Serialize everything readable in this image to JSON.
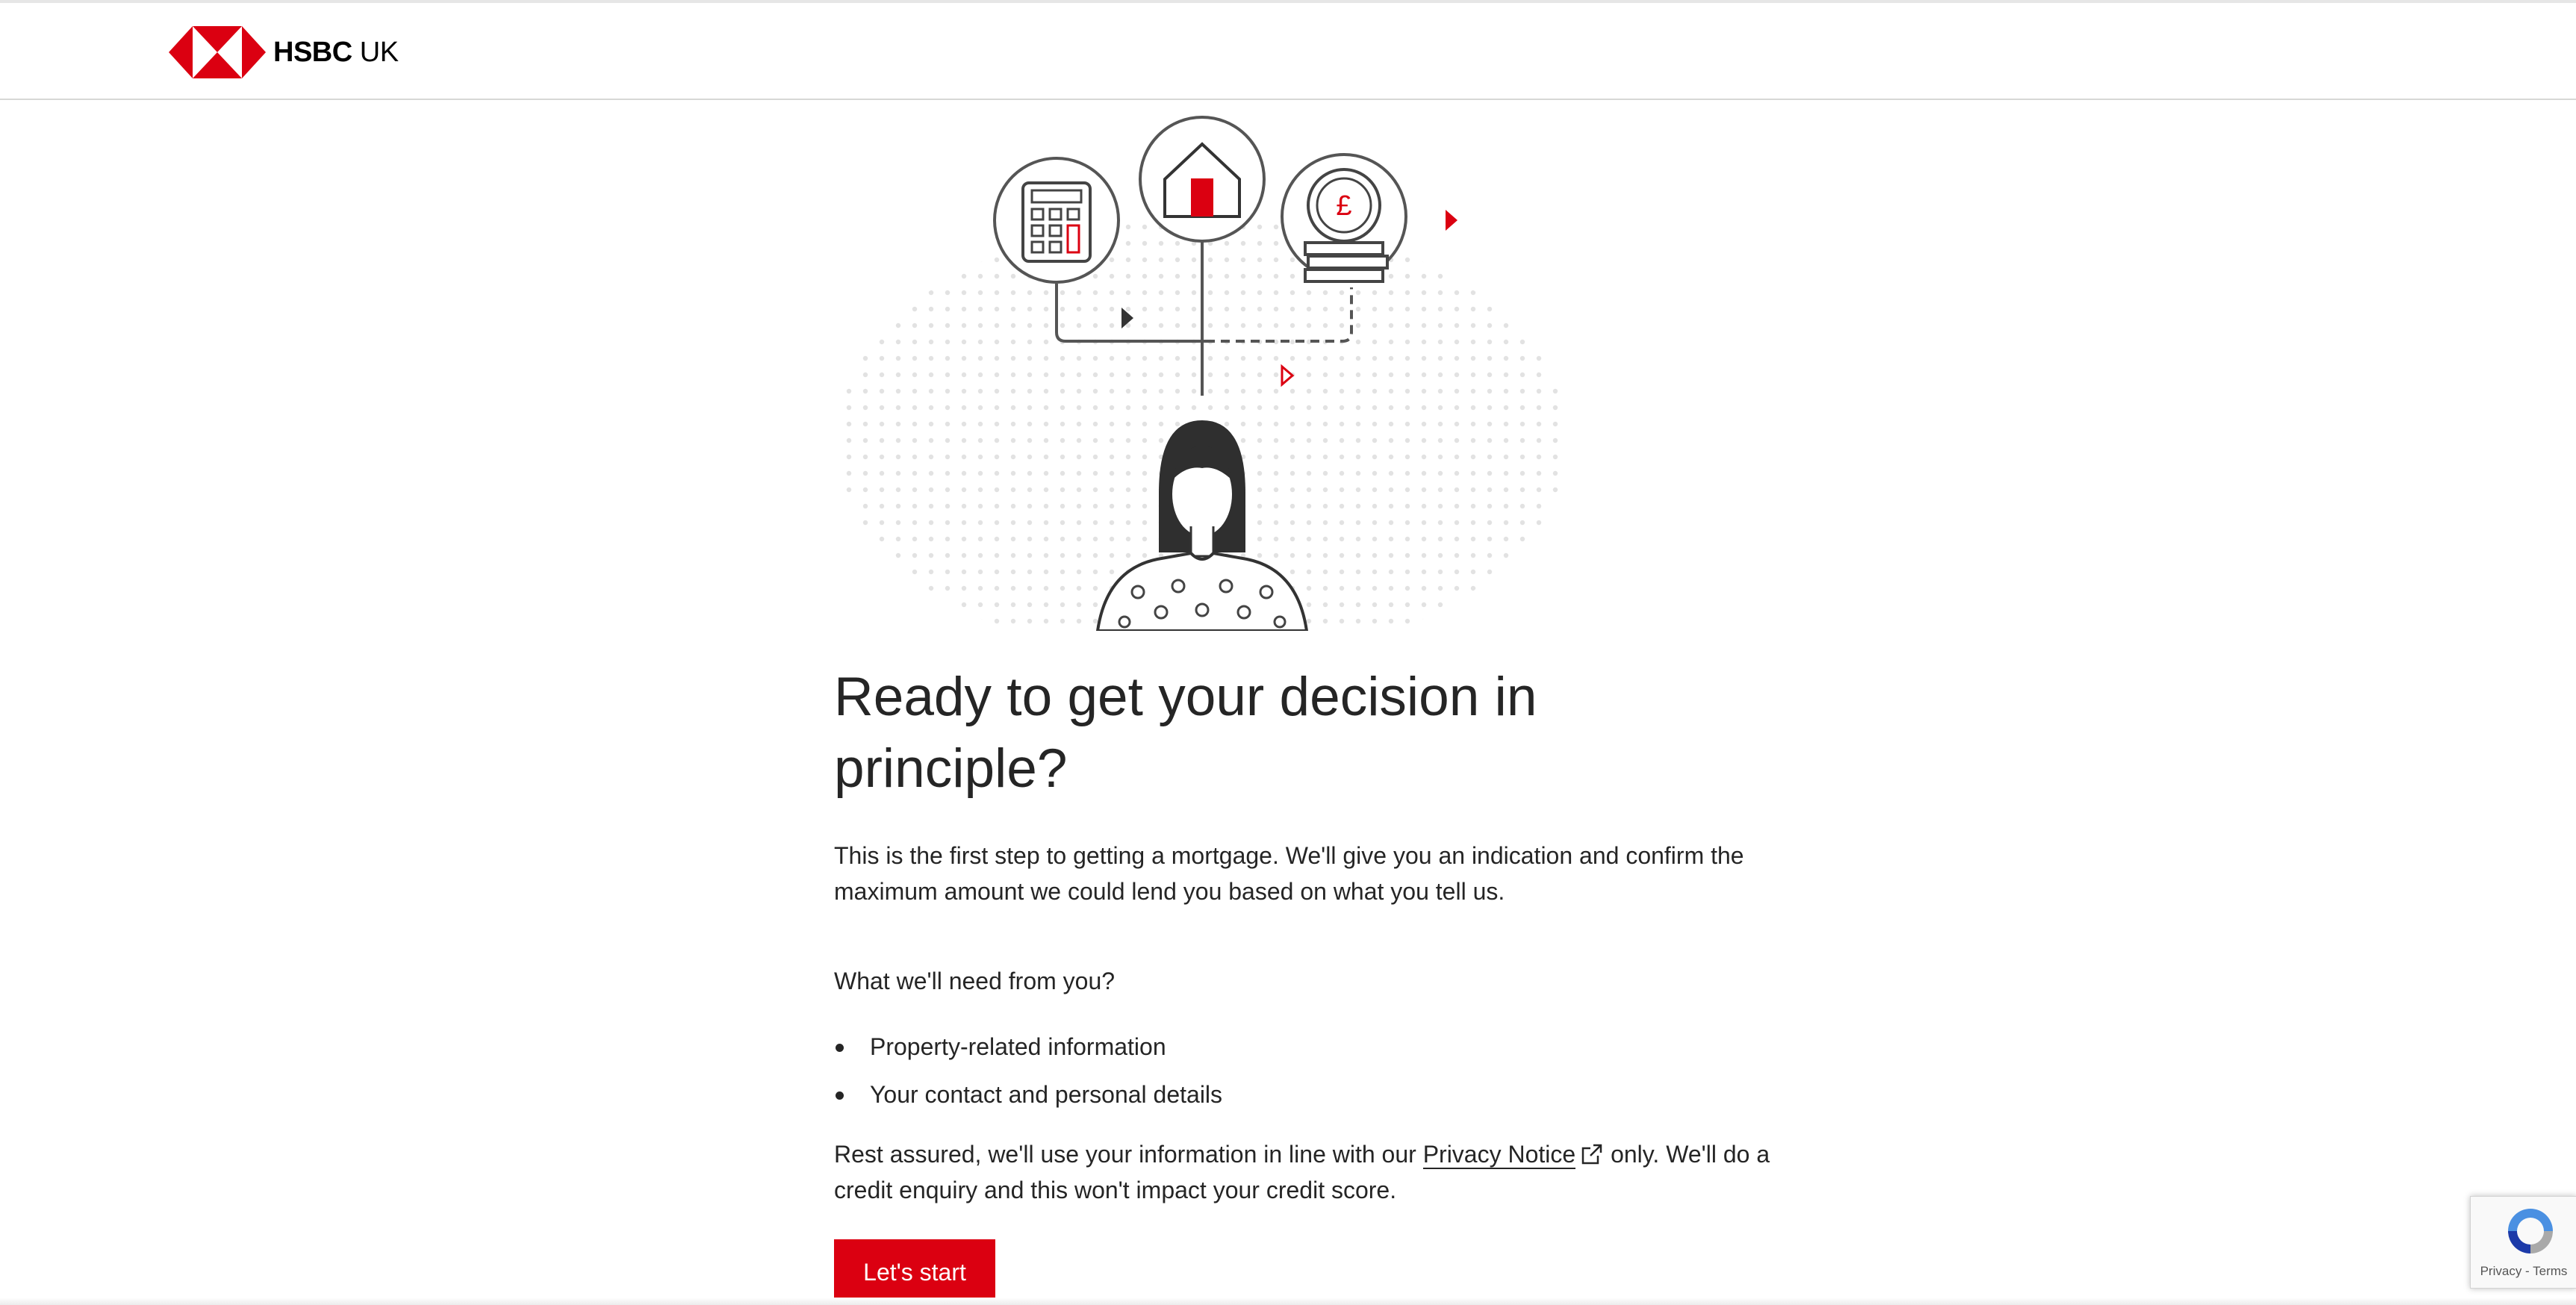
{
  "header": {
    "brand_bold": "HSBC",
    "brand_suffix": "UK"
  },
  "illustration": {
    "currency_symbol": "£"
  },
  "main": {
    "title": "Ready to get your decision in principle?",
    "intro": "This is the first step to getting a mortgage. We'll give you an indication and confirm the maximum amount we could lend you based on what you tell us.",
    "need_heading": "What we'll need from you?",
    "bullets": [
      "Property-related information",
      "Your contact and personal details"
    ],
    "privacy_before": "Rest assured, we'll use your information in line with our ",
    "privacy_link": "Privacy Notice",
    "privacy_after": " only. We'll do a credit enquiry and this won't impact your credit score.",
    "start_button": "Let's start"
  },
  "recaptcha": {
    "links": "Privacy - Terms"
  },
  "colors": {
    "brand_red": "#db0011",
    "text": "#252525",
    "line_gray": "#555555"
  }
}
